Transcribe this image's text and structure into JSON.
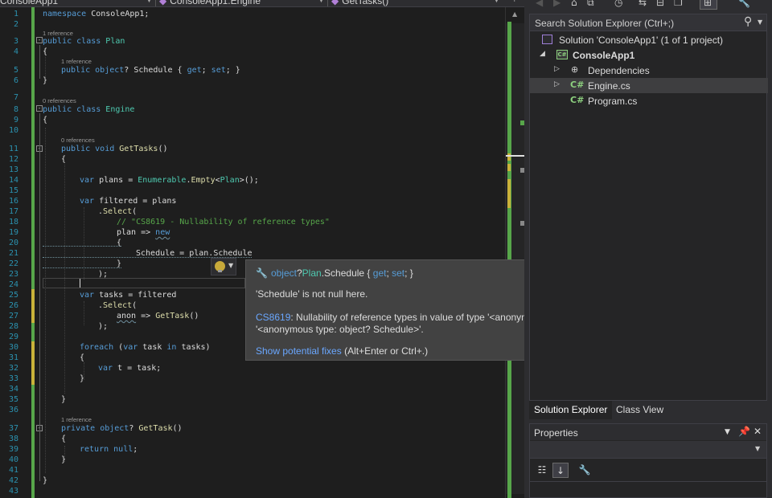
{
  "navbar": {
    "project": "ConsoleApp1",
    "type": "ConsoleApp1.Engine",
    "member": "GetTasks()"
  },
  "editor": {
    "lines": [
      "1",
      "2",
      "3",
      "4",
      "5",
      "6",
      "7",
      "8",
      "9",
      "10",
      "11",
      "12",
      "13",
      "14",
      "15",
      "16",
      "17",
      "18",
      "19",
      "20",
      "21",
      "22",
      "23",
      "24",
      "25",
      "26",
      "27",
      "28",
      "29",
      "30",
      "31",
      "32",
      "33",
      "34",
      "35",
      "36",
      "37",
      "38",
      "39",
      "40",
      "41",
      "42",
      "43"
    ],
    "refs": {
      "plan_class": "1 reference",
      "schedule_prop": "1 reference",
      "engine_class": "0 references",
      "gettasks": "0 references",
      "gettask": "1 reference"
    },
    "comment": "// \"CS8619 - Nullability of reference types\""
  },
  "tooltip": {
    "sig_type": "object",
    "sig_q": "?",
    "sig_class": "Plan",
    "sig_member": ".Schedule { ",
    "sig_get": "get",
    "sig_sc1": "; ",
    "sig_set": "set",
    "sig_end": "; }",
    "null_state": "'Schedule' is not null here.",
    "error_code": "CS8619",
    "error_line1": ": Nullability of reference types in value of type '<anonymous type: object Schedule>' doesn't match target type",
    "error_line2": "'<anonymous type: object? Schedule>'.",
    "fix_link": "Show potential fixes",
    "fix_shortcut": " (Alt+Enter or Ctrl+.)"
  },
  "solution_explorer": {
    "search_placeholder": "Search Solution Explorer (Ctrl+;)",
    "solution": "Solution 'ConsoleApp1' (1 of 1 project)",
    "project": "ConsoleApp1",
    "dependencies": "Dependencies",
    "files": [
      "Engine.cs",
      "Program.cs"
    ],
    "cs_icon_text": "C#",
    "tabs": [
      "Solution Explorer",
      "Class View"
    ]
  },
  "properties": {
    "title": "Properties"
  },
  "icons": [
    "gear-icon",
    "wrench-icon",
    "lightbulb-icon",
    "search-icon",
    "pin-icon",
    "close-icon",
    "categorized-icon",
    "alphabetical-icon",
    "property-pages-icon"
  ],
  "colors": {
    "keyword": "#569cd6",
    "type": "#4ec9b0",
    "method": "#dcdcaa",
    "comment": "#57a64a",
    "link": "#6aa7ff",
    "changed_saved": "#57a64a",
    "changed_unsaved": "#c9b23a"
  }
}
